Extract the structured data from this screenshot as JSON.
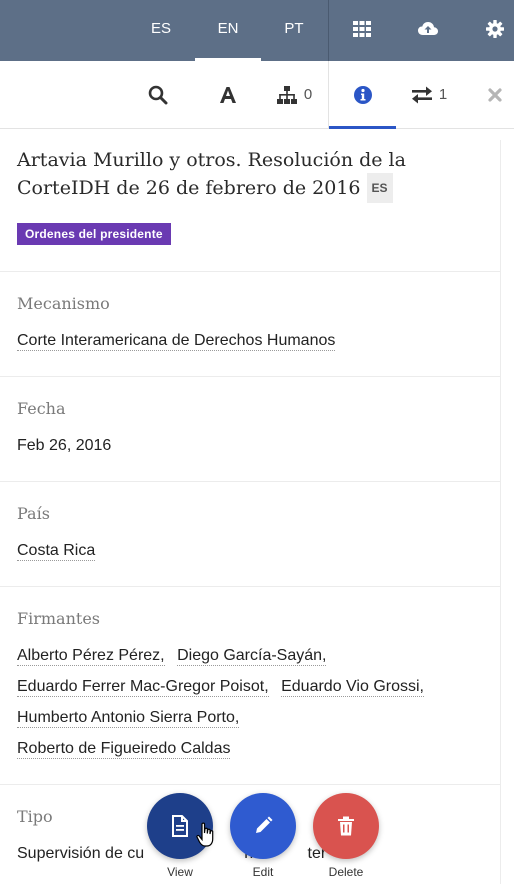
{
  "topbar": {
    "languages": [
      "ES",
      "EN",
      "PT"
    ],
    "active_language": "EN",
    "icons": [
      "grid-icon",
      "cloud-upload-icon",
      "gear-icon"
    ]
  },
  "toolbar": {
    "connections_count": "0",
    "relations_count": "1"
  },
  "document": {
    "title": "Artavia Murillo y otros. Resolución de la CorteIDH de 26 de febrero de 2016",
    "language_badge": "ES",
    "tag": "Ordenes del presidente"
  },
  "fields": {
    "mecanismo": {
      "label": "Mecanismo",
      "value": "Corte Interamericana de Derechos Humanos"
    },
    "fecha": {
      "label": "Fecha",
      "value": "Feb 26, 2016"
    },
    "pais": {
      "label": "País",
      "value": "Costa Rica"
    },
    "firmantes": {
      "label": "Firmantes",
      "values": [
        "Alberto Pérez Pérez,",
        "Diego García-Sayán,",
        "Eduardo Ferrer Mac-Gregor Poisot,",
        "Eduardo Vio Grossi,",
        "Humberto Antonio Sierra Porto,",
        "Roberto de Figueiredo Caldas"
      ]
    },
    "tipo": {
      "label": "Tipo",
      "value": "Supervisión de cu",
      "value_tail": "nt",
      "value_tail2": "ter"
    }
  },
  "actions": {
    "view_label": "View",
    "edit_label": "Edit",
    "delete_label": "Delete",
    "colors": {
      "view": "#1e3f8a",
      "edit": "#2f5bd0",
      "delete": "#d9534f"
    }
  }
}
